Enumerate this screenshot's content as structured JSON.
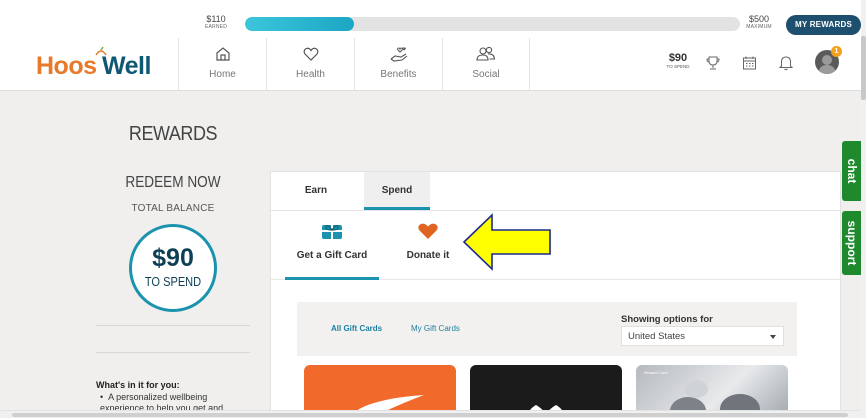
{
  "header": {
    "earned": {
      "amount": "$110",
      "label": "EARNED"
    },
    "progress_fraction": 0.22,
    "maximum": {
      "amount": "$500",
      "label": "MAXIMUM"
    },
    "my_rewards_label": "MY REWARDS",
    "logo": {
      "part1": "Hoos",
      "part2": "Well"
    },
    "nav": [
      {
        "label": "Home",
        "icon": "home-icon"
      },
      {
        "label": "Health",
        "icon": "heart-icon"
      },
      {
        "label": "Benefits",
        "icon": "hand-hearts-icon"
      },
      {
        "label": "Social",
        "icon": "people-icon"
      }
    ],
    "spend": {
      "amount": "$90",
      "label": "TO SPEND"
    },
    "avatar_badge": "1"
  },
  "sidebar": {
    "title": "REWARDS",
    "redeem_now": "REDEEM NOW",
    "total_balance": "TOTAL BALANCE",
    "balance": {
      "amount": "$90",
      "label": "TO SPEND"
    },
    "whats_in_it": "What's in it for you:",
    "bullet": "A personalized wellbeing experience to help you get and"
  },
  "main": {
    "tabs": [
      {
        "label": "Earn"
      },
      {
        "label": "Spend"
      }
    ],
    "options": [
      {
        "label": "Get a Gift Card",
        "icon": "gift-card-icon"
      },
      {
        "label": "Donate it",
        "icon": "heart-icon"
      }
    ],
    "filter": {
      "tabs": [
        {
          "label": "All Gift Cards"
        },
        {
          "label": "My Gift Cards"
        }
      ],
      "showing_label": "Showing options for",
      "country": "United States"
    },
    "cards": [
      {
        "brand": "Nike",
        "color": "#f26a2b"
      },
      {
        "brand": "Under Armour",
        "color": "#1b1b1b"
      },
      {
        "tag": "Reward Card"
      }
    ]
  },
  "side_tabs": {
    "chat": "chat",
    "support": "support"
  },
  "colors": {
    "accent": "#1b93ae",
    "brand_orange": "#e8792a",
    "brand_navy": "#0f5875",
    "side_tab_green": "#1e8a2d",
    "arrow_yellow": "#ffff00"
  }
}
